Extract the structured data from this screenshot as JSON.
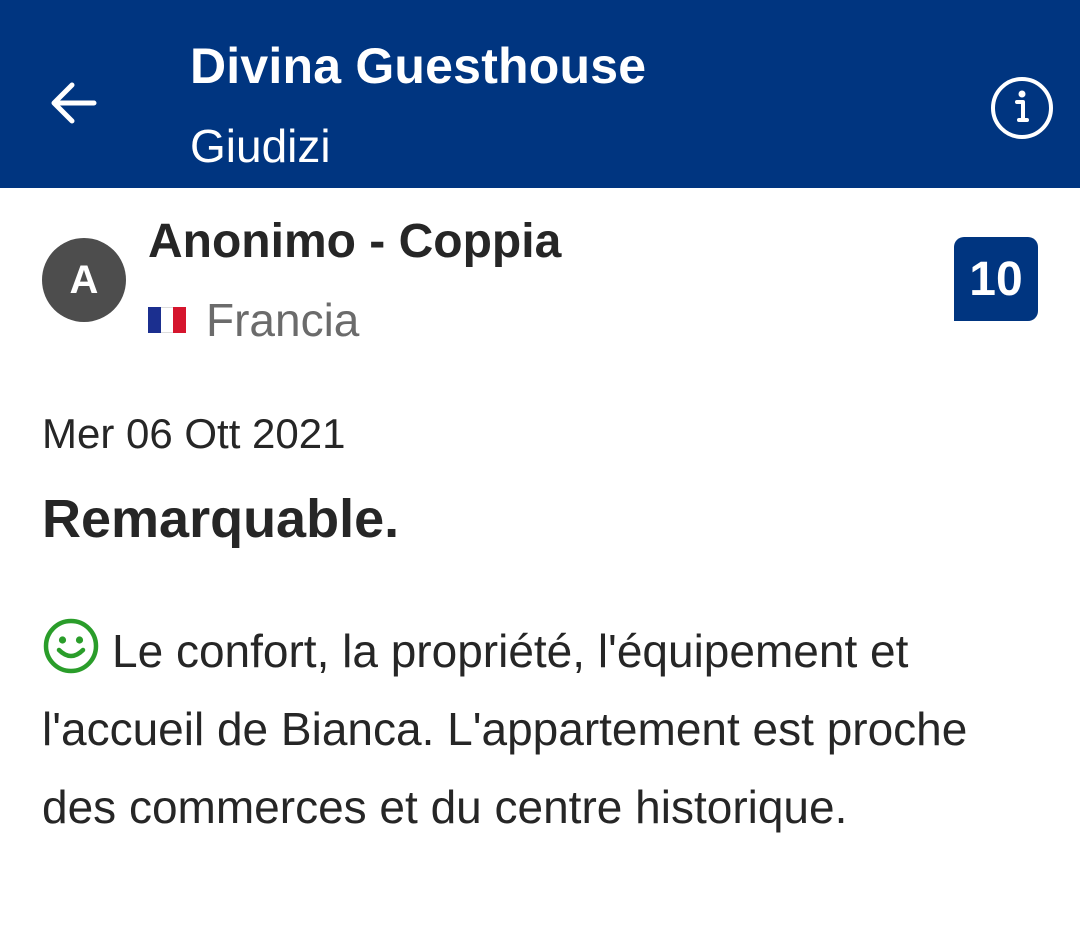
{
  "header": {
    "title": "Divina Guesthouse",
    "subtitle": "Giudizi",
    "back_icon": "arrow-left-icon",
    "info_icon": "info-circle-icon",
    "background_color": "#003580"
  },
  "review": {
    "avatar_initial": "A",
    "reviewer": "Anonimo - Coppia",
    "country": "Francia",
    "flag_icon": "france-flag-icon",
    "score": "10",
    "date": "Mer 06 Ott 2021",
    "title": "Remarquable.",
    "positive_icon": "smiley-icon",
    "positive_icon_color": "#2a9d2a",
    "positive_text": "Le confort, la propriété, l'équipement et l'accueil de Bianca. L'appartement est proche des commerces et du centre historique."
  }
}
